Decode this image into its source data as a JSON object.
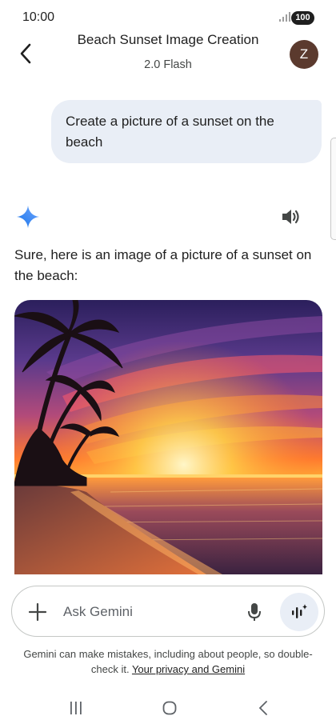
{
  "status_bar": {
    "time": "10:00",
    "battery": "100"
  },
  "header": {
    "title": "Beach Sunset Image Creation",
    "subtitle": "2.0 Flash",
    "avatar_initial": "Z"
  },
  "conversation": {
    "user_message": "Create a picture of a sunset on the beach",
    "response_text": "Sure, here is an image of a picture of a sunset on the beach:"
  },
  "input": {
    "placeholder": "Ask Gemini"
  },
  "footer": {
    "disclaimer": "Gemini can make mistakes, including about people, so double-check it.",
    "privacy_link": "Your privacy and Gemini"
  },
  "icons": {
    "back": "back-arrow-icon",
    "gemini": "gemini-sparkle-icon",
    "speaker": "speaker-icon",
    "plus": "plus-icon",
    "mic": "microphone-icon",
    "live": "gemini-live-icon",
    "recents": "recents-icon",
    "home": "home-icon",
    "nav_back": "nav-back-icon"
  },
  "colors": {
    "bubble": "#e9eef6",
    "avatar": "#5b3a2e",
    "gemini_blue": "#4285f4"
  }
}
